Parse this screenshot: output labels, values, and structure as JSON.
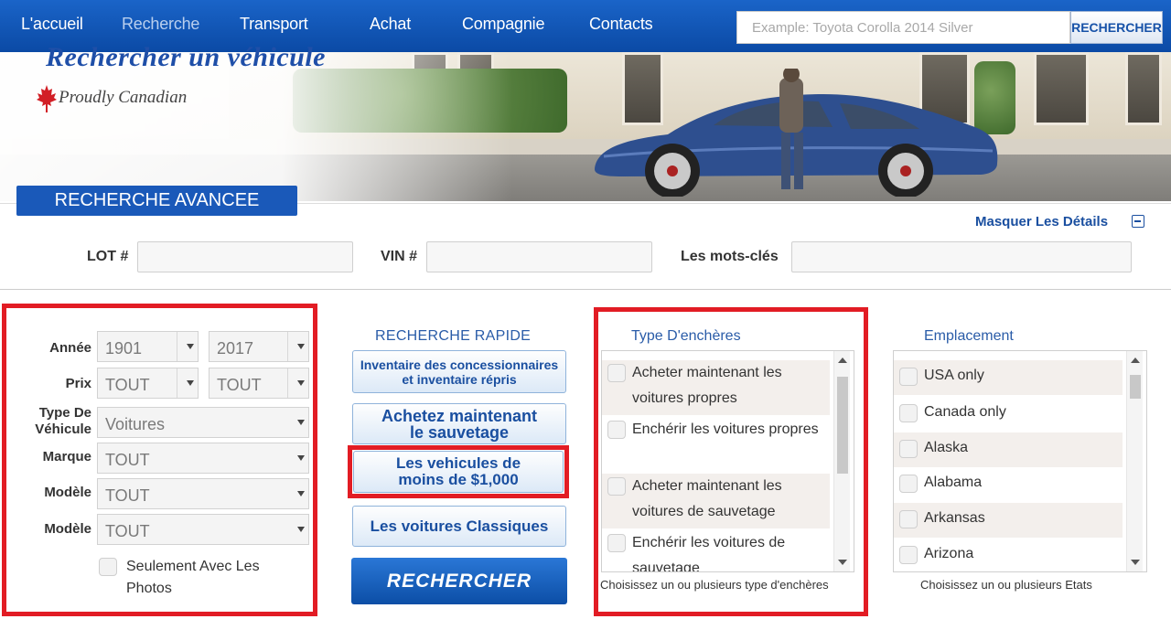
{
  "nav": {
    "items": [
      "L'accueil",
      "Recherche",
      "Transport",
      "Achat",
      "Compagnie",
      "Contacts"
    ],
    "search_placeholder": "Example: Toyota Corolla 2014 Silver",
    "search_button": "RECHERCHER"
  },
  "hero": {
    "title": "Rechercher un véhicule",
    "subtitle": "Proudly Canadian"
  },
  "advanced": {
    "tab_label": "RECHERCHE AVANCEE",
    "hide_details": "Masquer Les Détails",
    "lot_label": "LOT #",
    "vin_label": "VIN #",
    "keywords_label": "Les mots-clés"
  },
  "filters": {
    "year_label": "Année",
    "year_from": "1901",
    "year_to": "2017",
    "price_label": "Prix",
    "price_from": "TOUT",
    "price_to": "TOUT",
    "vehicle_type_label": "Type De Véhicule",
    "vehicle_type": "Voitures",
    "make_label": "Marque",
    "make": "TOUT",
    "model_label_1": "Modèle",
    "model_1": "TOUT",
    "model_label_2": "Modèle",
    "model_2": "TOUT",
    "photos_only": "Seulement Avec Les Photos"
  },
  "quick": {
    "title": "RECHERCHE RAPIDE",
    "btn1": "Inventaire des concessionnaires et inventaire répris",
    "btn2_line1": "Achetez maintenant",
    "btn2_line2": "le sauvetage",
    "btn3_line1": "Les vehicules de",
    "btn3_line2": "moins de $1,000",
    "btn4": "Les voitures Classiques",
    "go": "RECHERCHER"
  },
  "auction": {
    "title": "Type D'enchères",
    "items": [
      "Acheter maintenant les voitures propres",
      "Enchérir les voitures propres",
      "Acheter maintenant les voitures de sauvetage",
      "Enchérir les voitures de sauvetage"
    ],
    "hint": "Choisissez un ou plusieurs type d'enchères"
  },
  "location": {
    "title": "Emplacement",
    "items": [
      "USA only",
      "Canada only",
      "Alaska",
      "Alabama",
      "Arkansas",
      "Arizona"
    ],
    "hint": "Choisissez un ou plusieurs Etats"
  },
  "colors": {
    "nav_blue": "#1a64c8",
    "highlight_red": "#e21c24",
    "link_blue": "#1a4fa0"
  }
}
